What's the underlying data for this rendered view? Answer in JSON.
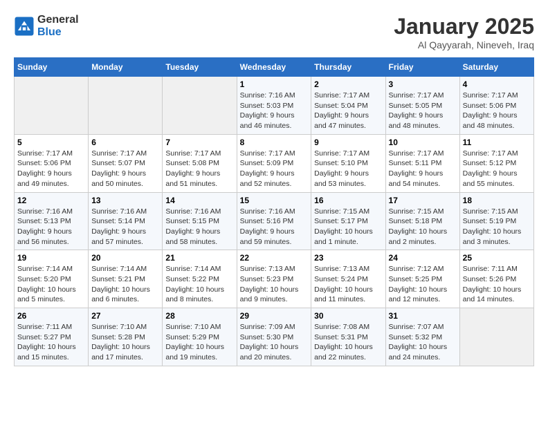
{
  "logo": {
    "general": "General",
    "blue": "Blue"
  },
  "header": {
    "title": "January 2025",
    "subtitle": "Al Qayyarah, Nineveh, Iraq"
  },
  "weekdays": [
    "Sunday",
    "Monday",
    "Tuesday",
    "Wednesday",
    "Thursday",
    "Friday",
    "Saturday"
  ],
  "weeks": [
    [
      {
        "day": "",
        "info": ""
      },
      {
        "day": "",
        "info": ""
      },
      {
        "day": "",
        "info": ""
      },
      {
        "day": "1",
        "info": "Sunrise: 7:16 AM\nSunset: 5:03 PM\nDaylight: 9 hours and 46 minutes."
      },
      {
        "day": "2",
        "info": "Sunrise: 7:17 AM\nSunset: 5:04 PM\nDaylight: 9 hours and 47 minutes."
      },
      {
        "day": "3",
        "info": "Sunrise: 7:17 AM\nSunset: 5:05 PM\nDaylight: 9 hours and 48 minutes."
      },
      {
        "day": "4",
        "info": "Sunrise: 7:17 AM\nSunset: 5:06 PM\nDaylight: 9 hours and 48 minutes."
      }
    ],
    [
      {
        "day": "5",
        "info": "Sunrise: 7:17 AM\nSunset: 5:06 PM\nDaylight: 9 hours and 49 minutes."
      },
      {
        "day": "6",
        "info": "Sunrise: 7:17 AM\nSunset: 5:07 PM\nDaylight: 9 hours and 50 minutes."
      },
      {
        "day": "7",
        "info": "Sunrise: 7:17 AM\nSunset: 5:08 PM\nDaylight: 9 hours and 51 minutes."
      },
      {
        "day": "8",
        "info": "Sunrise: 7:17 AM\nSunset: 5:09 PM\nDaylight: 9 hours and 52 minutes."
      },
      {
        "day": "9",
        "info": "Sunrise: 7:17 AM\nSunset: 5:10 PM\nDaylight: 9 hours and 53 minutes."
      },
      {
        "day": "10",
        "info": "Sunrise: 7:17 AM\nSunset: 5:11 PM\nDaylight: 9 hours and 54 minutes."
      },
      {
        "day": "11",
        "info": "Sunrise: 7:17 AM\nSunset: 5:12 PM\nDaylight: 9 hours and 55 minutes."
      }
    ],
    [
      {
        "day": "12",
        "info": "Sunrise: 7:16 AM\nSunset: 5:13 PM\nDaylight: 9 hours and 56 minutes."
      },
      {
        "day": "13",
        "info": "Sunrise: 7:16 AM\nSunset: 5:14 PM\nDaylight: 9 hours and 57 minutes."
      },
      {
        "day": "14",
        "info": "Sunrise: 7:16 AM\nSunset: 5:15 PM\nDaylight: 9 hours and 58 minutes."
      },
      {
        "day": "15",
        "info": "Sunrise: 7:16 AM\nSunset: 5:16 PM\nDaylight: 9 hours and 59 minutes."
      },
      {
        "day": "16",
        "info": "Sunrise: 7:15 AM\nSunset: 5:17 PM\nDaylight: 10 hours and 1 minute."
      },
      {
        "day": "17",
        "info": "Sunrise: 7:15 AM\nSunset: 5:18 PM\nDaylight: 10 hours and 2 minutes."
      },
      {
        "day": "18",
        "info": "Sunrise: 7:15 AM\nSunset: 5:19 PM\nDaylight: 10 hours and 3 minutes."
      }
    ],
    [
      {
        "day": "19",
        "info": "Sunrise: 7:14 AM\nSunset: 5:20 PM\nDaylight: 10 hours and 5 minutes."
      },
      {
        "day": "20",
        "info": "Sunrise: 7:14 AM\nSunset: 5:21 PM\nDaylight: 10 hours and 6 minutes."
      },
      {
        "day": "21",
        "info": "Sunrise: 7:14 AM\nSunset: 5:22 PM\nDaylight: 10 hours and 8 minutes."
      },
      {
        "day": "22",
        "info": "Sunrise: 7:13 AM\nSunset: 5:23 PM\nDaylight: 10 hours and 9 minutes."
      },
      {
        "day": "23",
        "info": "Sunrise: 7:13 AM\nSunset: 5:24 PM\nDaylight: 10 hours and 11 minutes."
      },
      {
        "day": "24",
        "info": "Sunrise: 7:12 AM\nSunset: 5:25 PM\nDaylight: 10 hours and 12 minutes."
      },
      {
        "day": "25",
        "info": "Sunrise: 7:11 AM\nSunset: 5:26 PM\nDaylight: 10 hours and 14 minutes."
      }
    ],
    [
      {
        "day": "26",
        "info": "Sunrise: 7:11 AM\nSunset: 5:27 PM\nDaylight: 10 hours and 15 minutes."
      },
      {
        "day": "27",
        "info": "Sunrise: 7:10 AM\nSunset: 5:28 PM\nDaylight: 10 hours and 17 minutes."
      },
      {
        "day": "28",
        "info": "Sunrise: 7:10 AM\nSunset: 5:29 PM\nDaylight: 10 hours and 19 minutes."
      },
      {
        "day": "29",
        "info": "Sunrise: 7:09 AM\nSunset: 5:30 PM\nDaylight: 10 hours and 20 minutes."
      },
      {
        "day": "30",
        "info": "Sunrise: 7:08 AM\nSunset: 5:31 PM\nDaylight: 10 hours and 22 minutes."
      },
      {
        "day": "31",
        "info": "Sunrise: 7:07 AM\nSunset: 5:32 PM\nDaylight: 10 hours and 24 minutes."
      },
      {
        "day": "",
        "info": ""
      }
    ]
  ]
}
